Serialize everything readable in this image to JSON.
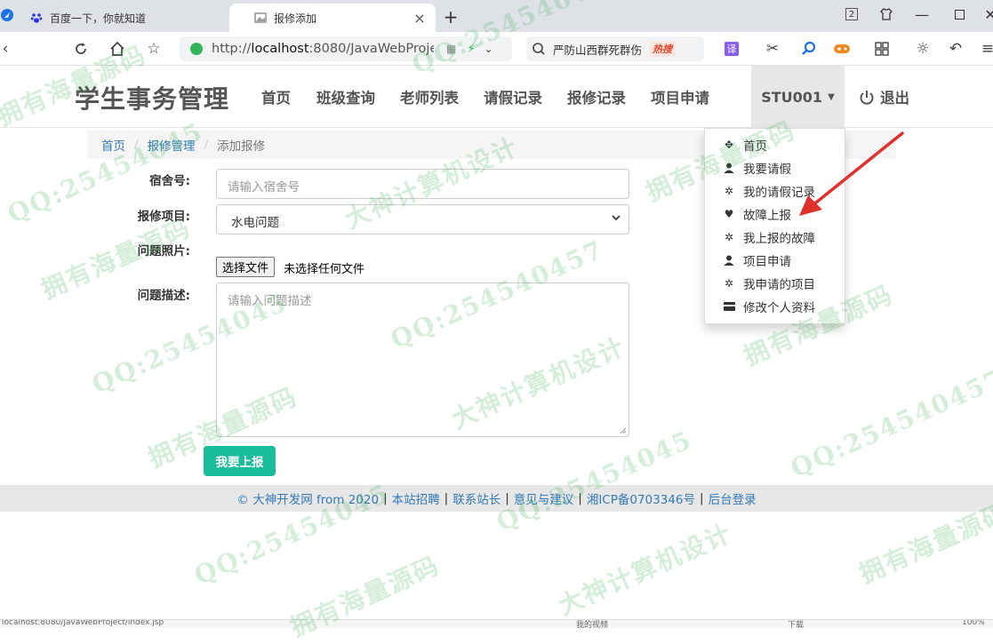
{
  "browser": {
    "tabs": [
      {
        "title": "百度一下，你就知道",
        "active": false
      },
      {
        "title": "报修添加",
        "active": true
      }
    ],
    "window_badge": "2",
    "url_prefix": "http://",
    "url_host": "localhost",
    "url_rest": ":8080/JavaWebProjec",
    "search_text": "严防山西群死群伤",
    "search_badge": "热搜",
    "translate_label": "译",
    "status_left": "localhost:8080/JavaWebProject/index.jsp",
    "status_right": "100%",
    "status_video": "我的视频",
    "status_download": "下载"
  },
  "site": {
    "brand": "学生事务管理",
    "nav": [
      "首页",
      "班级查询",
      "老师列表",
      "请假记录",
      "报修记录",
      "项目申请"
    ],
    "user": "STU001",
    "logout": "退出"
  },
  "breadcrumb": {
    "home": "首页",
    "section": "报修管理",
    "current": "添加报修",
    "separator": "/"
  },
  "form": {
    "dorm_label": "宿舍号:",
    "dorm_placeholder": "请输入宿舍号",
    "item_label": "报修项目:",
    "item_value": "水电问题",
    "photo_label": "问题照片:",
    "file_button": "选择文件",
    "file_status": "未选择任何文件",
    "desc_label": "问题描述:",
    "desc_placeholder": "请输入问题描述",
    "submit": "我要上报"
  },
  "dropdown": {
    "items": [
      {
        "label": "首页",
        "icon": "move-icon"
      },
      {
        "label": "我要请假",
        "icon": "user-icon"
      },
      {
        "label": "我的请假记录",
        "icon": "cog-icon"
      },
      {
        "label": "故障上报",
        "icon": "heart-icon"
      },
      {
        "label": "我上报的故障",
        "icon": "cog-icon"
      },
      {
        "label": "项目申请",
        "icon": "user-icon"
      },
      {
        "label": "我申请的项目",
        "icon": "cog-icon"
      },
      {
        "label": "修改个人资料",
        "icon": "credit-card-icon"
      }
    ]
  },
  "footer": {
    "copyright": "© 大神开发网 from 2020",
    "links": [
      "本站招聘",
      "联系站长",
      "意见与建议",
      "湘ICP备0703346号",
      "后台登录"
    ],
    "separator": "|"
  },
  "watermark": {
    "qq": "QQ:25454045",
    "qq_full": "QQ:254540457",
    "slogan1": "大神计算机设计",
    "slogan2": "拥有海量源码"
  },
  "colors": {
    "accent": "#1abc9c",
    "link": "#337ab7",
    "arrow": "#e0322d"
  }
}
